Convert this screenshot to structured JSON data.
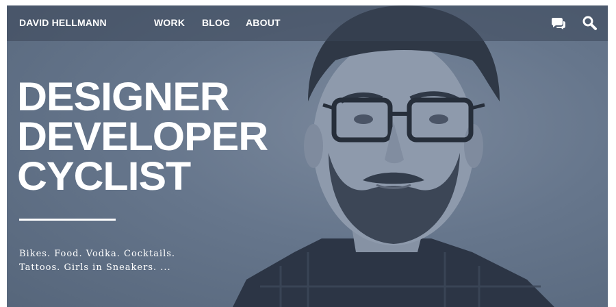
{
  "header": {
    "brand": "DAVID HELLMANN",
    "nav": [
      {
        "label": "WORK"
      },
      {
        "label": "BLOG"
      },
      {
        "label": "ABOUT"
      }
    ],
    "icons": [
      "chat-icon",
      "search-icon"
    ]
  },
  "hero": {
    "headline": [
      "DESIGNER",
      "DEVELOPER",
      "CYCLIST"
    ],
    "tagline": [
      "Bikes. Food. Vodka. Cocktails.",
      "Tattoos. Girls in Sneakers. ..."
    ]
  },
  "colors": {
    "overlay": "#66768c",
    "text": "#ffffff"
  }
}
